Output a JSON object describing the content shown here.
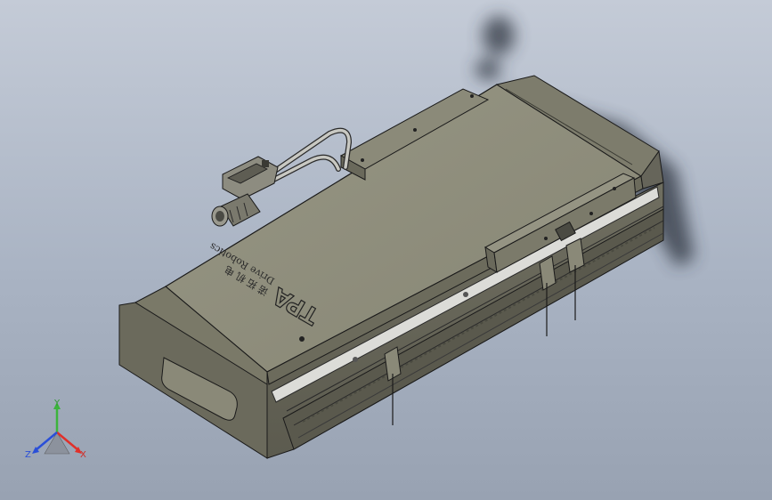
{
  "viewport": {
    "background_top": "#c4cbd7",
    "background_bottom": "#98a2b2"
  },
  "model": {
    "brand_logo": "TPA",
    "engraving_cn": "诺 拓 机 电",
    "engraving_en": "Drive Robotics",
    "body_color": "#7b7a6b",
    "top_color": "#8e8d7c",
    "edge_color": "#1a1a1a",
    "rail_color": "#dcdcd8",
    "shadow_color": "#2d3440"
  },
  "triad": {
    "x_label": "X",
    "y_label": "Y",
    "z_label": "Z",
    "x_color": "#e0302a",
    "y_color": "#3cb43c",
    "z_color": "#2a4fd8"
  }
}
